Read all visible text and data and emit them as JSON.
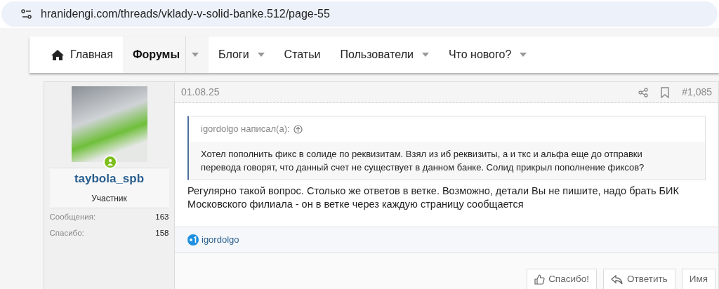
{
  "address_bar": {
    "url": "hranidengi.com/threads/vklady-v-solid-banke.512/page-55"
  },
  "nav": [
    {
      "label": "Главная",
      "kind": "home",
      "selected": false,
      "has_menu": false
    },
    {
      "label": "Форумы",
      "kind": "plain",
      "selected": true,
      "has_menu": true
    },
    {
      "label": "Блоги",
      "kind": "plain",
      "selected": false,
      "has_menu": true
    },
    {
      "label": "Статьи",
      "kind": "plain",
      "selected": false,
      "has_menu": false
    },
    {
      "label": "Пользователи",
      "kind": "plain",
      "selected": false,
      "has_menu": true
    },
    {
      "label": "Что нового?",
      "kind": "plain",
      "selected": false,
      "has_menu": true
    }
  ],
  "post": {
    "user": {
      "name": "taybola_spb",
      "online": true,
      "title": "Участник",
      "stats": [
        {
          "label": "Сообщения:",
          "value": "163"
        },
        {
          "label": "Спасибо:",
          "value": "158"
        }
      ]
    },
    "date": "01.08.25",
    "number": "#1,085",
    "quote": {
      "author": "igordolgo написал(а):",
      "text": "Хотел пополнить фикс в солиде по реквизитам. Взял из иб реквизиты, а и ткс и альфа еще до отправки перевода говорят, что данный счет не существует в данном банке. Солид прикрыл пополнение фиксов?"
    },
    "body": "Регулярно такой вопрос. Столько же ответов в ветке. Возможно, детали Вы не пишите, надо брать БИК Московского филиала - он в ветке через каждую страницу сообщается",
    "reactions": {
      "users": [
        "igordolgo"
      ]
    },
    "actions": [
      {
        "label": "Спасибо!",
        "kind": "like"
      },
      {
        "label": "Ответить",
        "kind": "reply"
      },
      {
        "label": "Имя",
        "kind": "plain"
      }
    ]
  }
}
